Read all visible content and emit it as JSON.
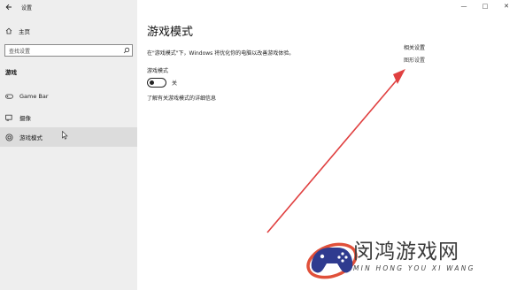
{
  "window": {
    "app_title": "设置",
    "controls": {
      "minimize": "—",
      "maximize": "□",
      "close": "✕"
    }
  },
  "sidebar": {
    "home_label": "主页",
    "search_placeholder": "查找设置",
    "section_label": "游戏",
    "items": [
      {
        "label": "Game Bar",
        "icon": "gamebar-icon",
        "selected": false
      },
      {
        "label": "摄像",
        "icon": "capture-icon",
        "selected": false
      },
      {
        "label": "游戏模式",
        "icon": "game-mode-icon",
        "selected": true
      }
    ]
  },
  "main": {
    "title": "游戏模式",
    "description": "在\"游戏模式\"下，Windows 将优化你的电脑以改善游戏体验。",
    "toggle_label": "游戏模式",
    "toggle_state": "关",
    "toggle_on": false,
    "learn_more": "了解有关游戏模式的详细信息"
  },
  "related": {
    "title": "相关设置",
    "link": "图形设置"
  },
  "watermark": {
    "cn": "闵鸿游戏网",
    "en": "MIN HONG YOU XI WANG"
  },
  "colors": {
    "sidebar_bg": "#eeeeee",
    "selected_bg": "#dcdcdc",
    "arrow": "#e04040"
  }
}
